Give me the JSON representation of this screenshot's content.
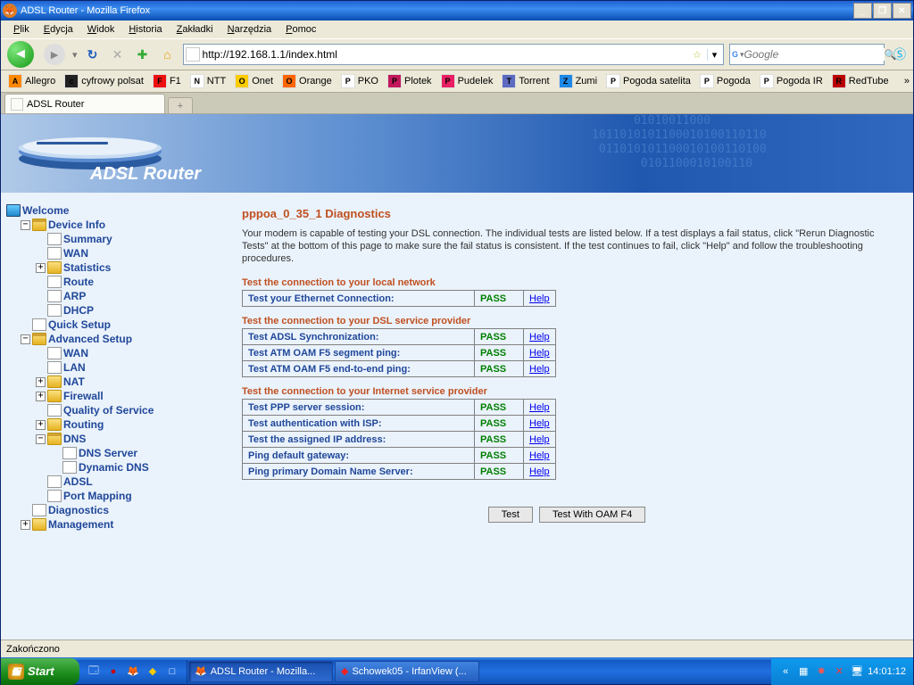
{
  "window": {
    "title": "ADSL Router - Mozilla Firefox"
  },
  "menubar": [
    "Plik",
    "Edycja",
    "Widok",
    "Historia",
    "Zakładki",
    "Narzędzia",
    "Pomoc"
  ],
  "url": "http://192.168.1.1/index.html",
  "search_placeholder": "Google",
  "bookmarks": [
    "Allegro",
    "cyfrowy polsat",
    "F1",
    "NTT",
    "Onet",
    "Orange",
    "PKO",
    "Plotek",
    "Pudelek",
    "Torrent",
    "Zumi",
    "Pogoda satelita",
    "Pogoda",
    "Pogoda IR",
    "RedTube"
  ],
  "tab_title": "ADSL Router",
  "banner_product": "ADSL Router",
  "tree": {
    "welcome": "Welcome",
    "device_info": "Device Info",
    "summary": "Summary",
    "wan": "WAN",
    "statistics": "Statistics",
    "route": "Route",
    "arp": "ARP",
    "dhcp": "DHCP",
    "quick_setup": "Quick Setup",
    "advanced_setup": "Advanced Setup",
    "as_wan": "WAN",
    "as_lan": "LAN",
    "as_nat": "NAT",
    "as_firewall": "Firewall",
    "as_qos": "Quality of Service",
    "as_routing": "Routing",
    "as_dns": "DNS",
    "as_dns_server": "DNS Server",
    "as_dyndns": "Dynamic DNS",
    "as_adsl": "ADSL",
    "as_portmap": "Port Mapping",
    "diagnostics": "Diagnostics",
    "management": "Management"
  },
  "page": {
    "title": "pppoa_0_35_1 Diagnostics",
    "desc": "Your modem is capable of testing your DSL connection. The individual tests are listed below. If a test displays a fail status, click \"Rerun Diagnostic Tests\" at the bottom of this page to make sure the fail status is consistent. If the test continues to fail, click \"Help\" and follow the troubleshooting procedures.",
    "sect1": "Test the connection to your local network",
    "rows1": [
      [
        "Test your Ethernet Connection:",
        "PASS",
        "Help"
      ]
    ],
    "sect2": "Test the connection to your DSL service provider",
    "rows2": [
      [
        "Test ADSL Synchronization:",
        "PASS",
        "Help"
      ],
      [
        "Test ATM OAM F5 segment ping:",
        "PASS",
        "Help"
      ],
      [
        "Test ATM OAM F5 end-to-end ping:",
        "PASS",
        "Help"
      ]
    ],
    "sect3": "Test the connection to your Internet service provider",
    "rows3": [
      [
        "Test PPP server session:",
        "PASS",
        "Help"
      ],
      [
        "Test authentication with ISP:",
        "PASS",
        "Help"
      ],
      [
        "Test the assigned IP address:",
        "PASS",
        "Help"
      ],
      [
        "Ping default gateway:",
        "PASS",
        "Help"
      ],
      [
        "Ping primary Domain Name Server:",
        "PASS",
        "Help"
      ]
    ],
    "btn_test": "Test",
    "btn_test_oam": "Test With OAM F4"
  },
  "status": "Zakończono",
  "taskbar": {
    "start": "Start",
    "items": [
      "ADSL Router - Mozilla...",
      "Schowek05 - IrfanView (..."
    ],
    "clock": "14:01:12"
  }
}
